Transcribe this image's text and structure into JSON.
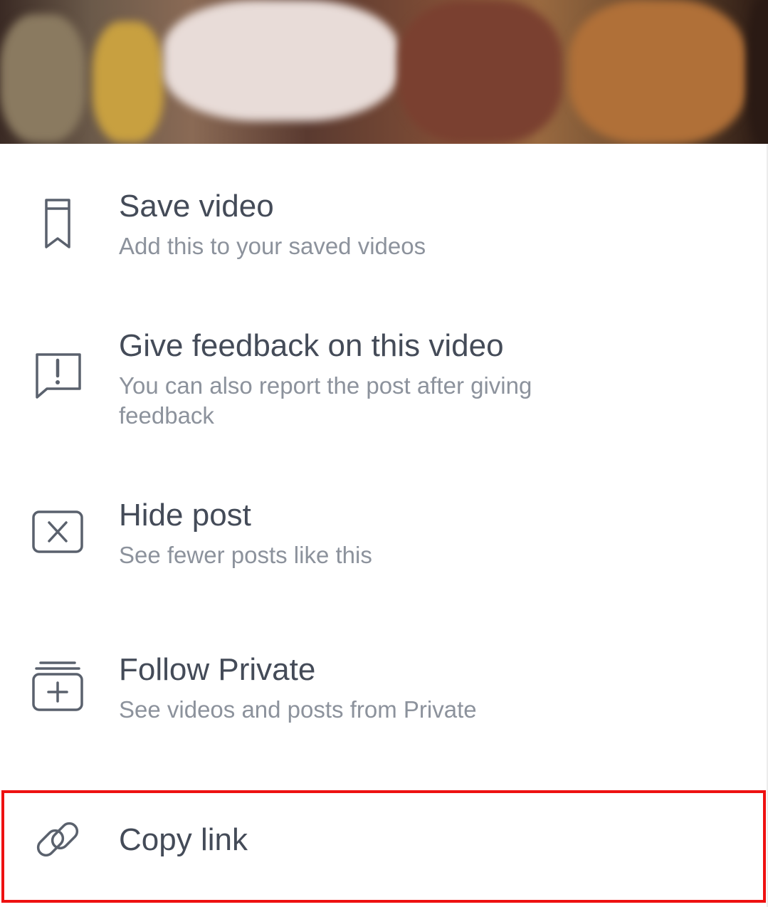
{
  "menu": {
    "items": [
      {
        "title": "Save video",
        "subtitle": "Add this to your saved videos",
        "icon": "bookmark-icon"
      },
      {
        "title": "Give feedback on this video",
        "subtitle": "You can also report the post after giving feedback",
        "icon": "feedback-icon"
      },
      {
        "title": "Hide post",
        "subtitle": "See fewer posts like this",
        "icon": "hide-icon"
      },
      {
        "title": "Follow Private",
        "subtitle": "See videos and posts from Private",
        "icon": "follow-icon"
      },
      {
        "title": "Copy link",
        "icon": "link-icon"
      }
    ]
  },
  "colors": {
    "title_text": "#444b58",
    "subtitle_text": "#8c929c",
    "icon_stroke": "#5a616d",
    "highlight_border": "#ee1111"
  }
}
